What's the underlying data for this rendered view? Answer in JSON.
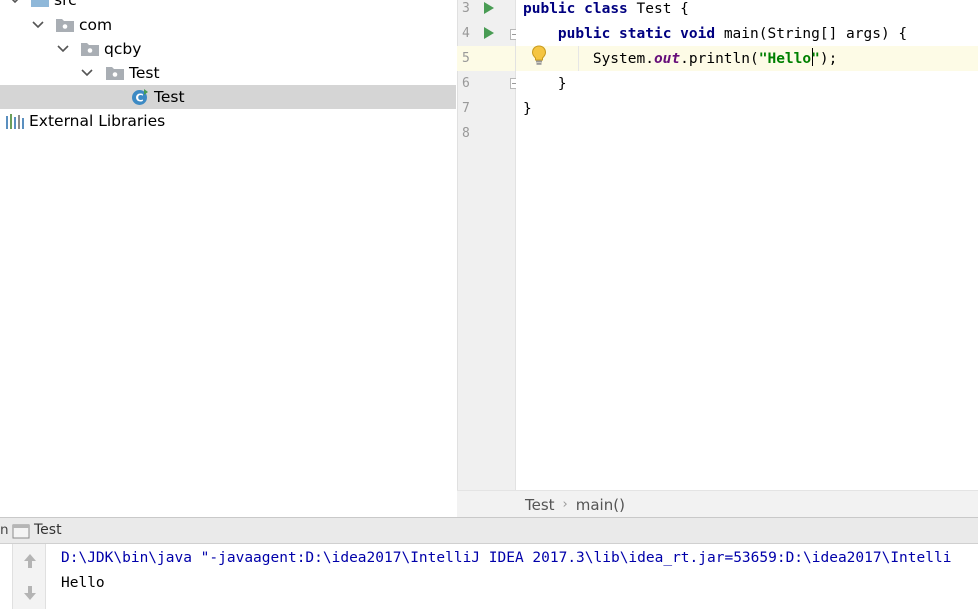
{
  "project_tree": {
    "items": [
      {
        "label": "src",
        "type": "source-folder",
        "expanded": true
      },
      {
        "label": "com",
        "type": "package",
        "expanded": true
      },
      {
        "label": "qcby",
        "type": "package",
        "expanded": true
      },
      {
        "label": "Test",
        "type": "package",
        "expanded": true
      },
      {
        "label": "Test",
        "type": "class",
        "selected": true
      },
      {
        "label": "External Libraries",
        "type": "libraries"
      }
    ]
  },
  "editor": {
    "line_numbers": [
      "3",
      "4",
      "5",
      "6",
      "7",
      "8"
    ],
    "current_line": "5",
    "code": {
      "line3": {
        "kw1": "public",
        "kw2": "class",
        "rest": " Test {"
      },
      "line4": {
        "indent": "    ",
        "kw1": "public",
        "kw2": "static",
        "kw3": "void",
        "rest": " main(String[] args) {"
      },
      "line5": {
        "indent": "        ",
        "pre": "System.",
        "field": "out",
        "mid": ".println(",
        "str_before_caret": "\"Hello",
        "str_after_caret": "\"",
        "post": ");"
      },
      "line6": {
        "indent": "    ",
        "rest": "}"
      },
      "line7": {
        "rest": "}"
      }
    }
  },
  "breadcrumbs": {
    "class": "Test",
    "method": "main()"
  },
  "run_panel": {
    "header_prefix": "n",
    "tab_label": "Test",
    "console_lines": {
      "command": "D:\\JDK\\bin\\java \"-javaagent:D:\\idea2017\\IntelliJ IDEA 2017.3\\lib\\idea_rt.jar=53659:D:\\idea2017\\Intelli",
      "output": "Hello"
    }
  },
  "colors": {
    "keyword": "#000080",
    "string": "#008000",
    "static_field": "#660e7a",
    "run_marker": "#499c54",
    "current_line": "#fdfbe6",
    "selection": "#d5d5d5"
  }
}
